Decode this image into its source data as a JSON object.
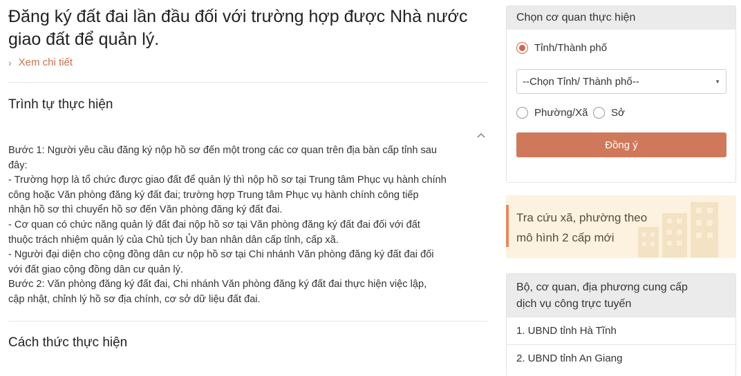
{
  "main": {
    "title": "Đăng ký đất đai lần đầu đối với trường hợp được Nhà nước giao đất để quản lý.",
    "detail_link": "Xem chi tiết",
    "section1_title": "Trình tự thực hiện",
    "section1_lines": [
      "Bước 1: Người yêu cầu đăng ký nộp hồ sơ đến một trong các cơ quan trên địa bàn cấp tỉnh sau",
      "đây:",
      "- Trường hợp là tổ chức được giao đất để quản lý thì nộp hồ sơ tại Trung tâm Phục vụ hành chính",
      "công hoặc Văn phòng đăng ký đất đai; trường hợp Trung tâm Phục vụ hành chính công tiếp",
      "nhận hồ sơ thì chuyển hồ sơ đến Văn phòng đăng ký đất đai.",
      "- Cơ quan có chức năng quản lý đất đai nộp hồ sơ tại Văn phòng đăng ký đất đai đối với đất",
      "thuộc trách nhiệm quản lý của Chủ tịch Ủy ban nhân dân cấp tỉnh, cấp xã.",
      "- Người đại diện cho cộng đồng dân cư nộp hồ sơ tại Chi nhánh Văn phòng đăng ký đất đai đối",
      "với đất giao cộng đồng dân cư quản lý.",
      "Bước 2: Văn phòng đăng ký đất đai, Chi nhánh Văn phòng đăng ký đất đai thực hiện việc lập,",
      "cập nhật, chỉnh lý hồ sơ địa chính, cơ sở dữ liệu đất đai."
    ],
    "section2_title": "Cách thức thực hiện"
  },
  "agency_card": {
    "title": "Chọn cơ quan thực hiện",
    "radio_province": "Tỉnh/Thành phố",
    "select_value": "--Chọn Tỉnh/ Thành phố--",
    "radio_ward": "Phường/Xã",
    "radio_dept": "Sở",
    "submit_label": "Đồng ý"
  },
  "banner": {
    "line1": "Tra cứu xã, phường theo",
    "line2": "mô hình 2 cấp mới"
  },
  "providers": {
    "title_line1": "Bộ, cơ quan, địa phương cung cấp",
    "title_line2": "dịch vụ công trực tuyến",
    "items": [
      "1. UBND tỉnh Hà Tĩnh",
      "2. UBND tỉnh An Giang"
    ]
  },
  "colors": {
    "accent": "#d0785a",
    "link": "#c8714f",
    "banner_bg": "#fdf2df"
  }
}
